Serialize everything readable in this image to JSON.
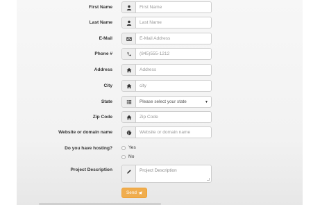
{
  "form": {
    "first_name": {
      "label": "First Name",
      "placeholder": "First Name",
      "icon": "user-icon"
    },
    "last_name": {
      "label": "Last Name",
      "placeholder": "Last Name",
      "icon": "user-icon"
    },
    "email": {
      "label": "E-Mail",
      "placeholder": "E-Mail Address",
      "icon": "envelope-icon"
    },
    "phone": {
      "label": "Phone #",
      "placeholder": "(845)555-1212",
      "icon": "phone-icon"
    },
    "address": {
      "label": "Address",
      "placeholder": "Address",
      "icon": "home-icon"
    },
    "city": {
      "label": "City",
      "placeholder": "city",
      "icon": "home-icon"
    },
    "state": {
      "label": "State",
      "selected": "Please select your state",
      "icon": "list-icon"
    },
    "zip": {
      "label": "Zip Code",
      "placeholder": "Zip Code",
      "icon": "home-icon"
    },
    "website": {
      "label": "Website or domain name",
      "placeholder": "Website or domain name",
      "icon": "globe-icon"
    },
    "hosting": {
      "label": "Do you have hosting?",
      "options": [
        "Yes",
        "No"
      ]
    },
    "project": {
      "label": "Project Description",
      "placeholder": "Project Description",
      "icon": "pencil-icon"
    },
    "send_label": "Send"
  },
  "colors": {
    "accent": "#f0ad4e",
    "addon_bg": "#eeeeee",
    "border": "#cccccc"
  }
}
